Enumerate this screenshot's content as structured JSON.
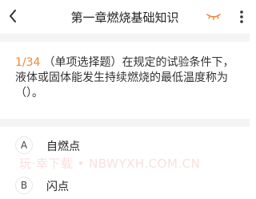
{
  "header": {
    "title": "第一章燃烧基础知识",
    "icons": {
      "back": "chevron-left-icon",
      "eye": "eye-closed-icon",
      "more": "more-vertical-icon"
    },
    "accent_color": "#f0883a"
  },
  "question": {
    "number": "1/34",
    "text": "（单项选择题）在规定的试验条件下，液体或固体能发生持续燃烧的最低温度称为（）。"
  },
  "options": [
    {
      "letter": "A",
      "text": "自燃点"
    },
    {
      "letter": "B",
      "text": "闪点"
    }
  ],
  "watermark": "玩·幸下载 • NBWYXH.COM.CN"
}
